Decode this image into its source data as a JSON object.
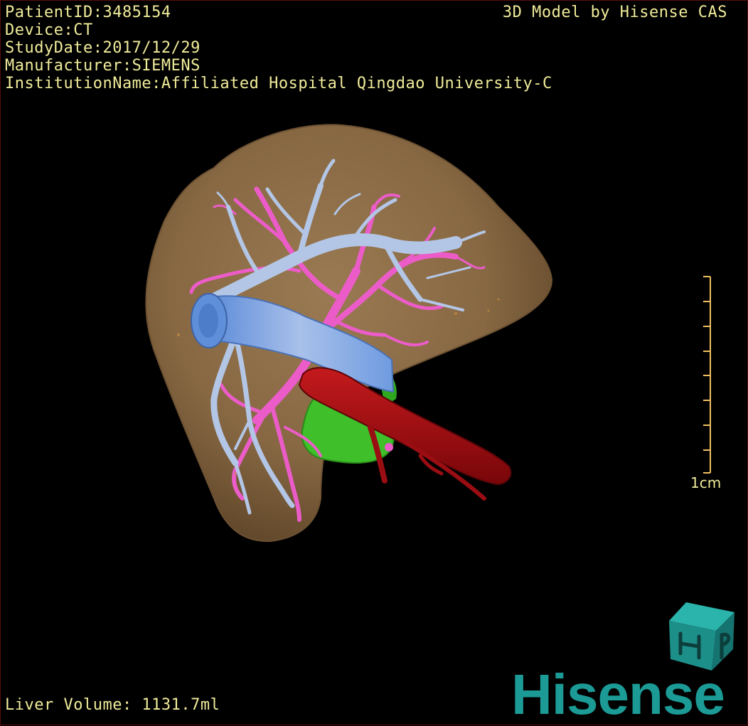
{
  "patient": {
    "lines": [
      "PatientID:3485154",
      "Device:CT",
      "StudyDate:2017/12/29",
      "Manufacturer:SIEMENS",
      "InstitutionName:Affiliated Hospital Qingdao University-C"
    ]
  },
  "credit": "3D Model by Hisense CAS",
  "volume_text": "Liver Volume: 1131.7ml",
  "scale": {
    "label": "1cm"
  },
  "brand": {
    "name": "Hisense",
    "cube_letters": "HP"
  },
  "colors": {
    "overlay_text": "#f0ec9a",
    "liver": "#8a6a44",
    "portal_vein": "#ec5cc9",
    "hepatic_vein": "#b3c6e6",
    "ivc": "#6f9ee0",
    "aorta": "#a30d12",
    "gallbladder": "#3fbf2a",
    "brand": "#1b9a96"
  },
  "icons": {
    "scale": "scale-ruler-icon",
    "logo": "hisense-cube-logo-icon"
  }
}
